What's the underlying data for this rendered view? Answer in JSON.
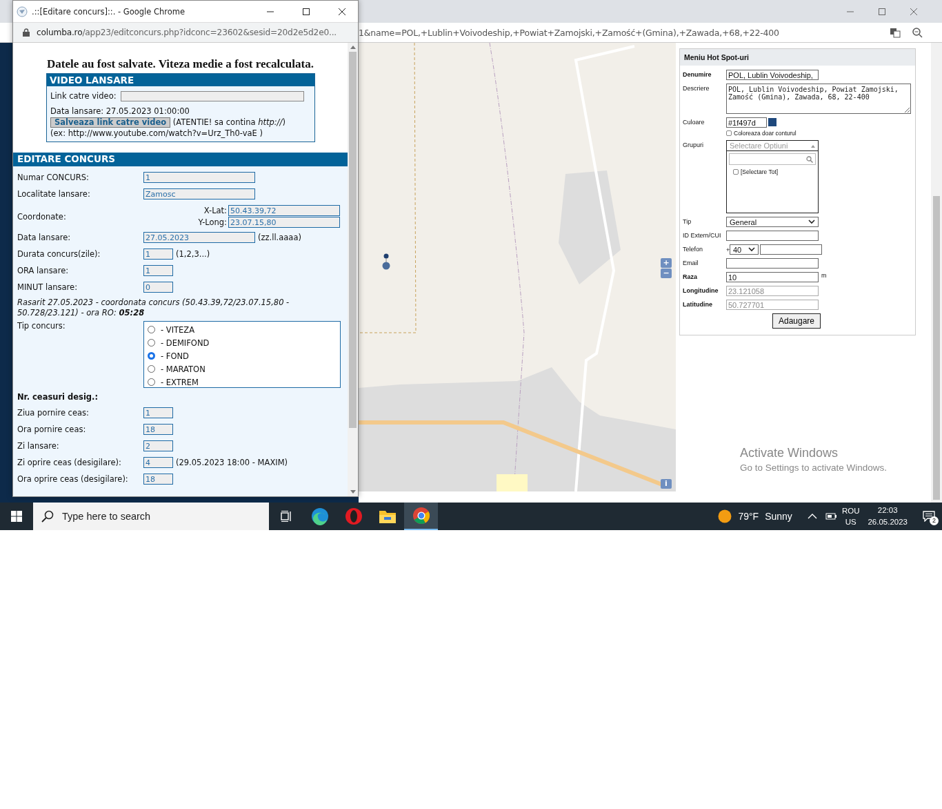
{
  "background_window": {
    "url": "1&name=POL,+Lublin+Voivodeship,+Powiat+Zamojski,+Zamość+(Gmina),+Zawada,+68,+22-400",
    "map": {
      "zoom_in": "+",
      "zoom_out": "−",
      "info": "i"
    },
    "panel": {
      "title": "Meniu Hot Spot-uri",
      "name_label": "Denumire",
      "name_value": "POL, Lublin Voivodeship,",
      "desc_label": "Descriere",
      "desc_value": "POL, Lublin Voivodeship, Powiat Zamojski, Zamość (Gmina), Zawada, 68, 22-400",
      "color_label": "Culoare",
      "color_value": "#1f497d",
      "outline_label": "Coloreaza doar conturul",
      "outline_checked": false,
      "groups_label": "Grupuri",
      "groups_placeholder": "Selectare Optiuni",
      "groups_expanded": true,
      "groups_options": [
        {
          "label": "[Selectare Tot]",
          "checked": false
        }
      ],
      "type_label": "Tip",
      "type_value": "General",
      "extid_label": "ID Extern/CUI",
      "phone_label": "Telefon",
      "phone_plus": "+",
      "phone_prefix": "40",
      "email_label": "Email",
      "radius_label": "Raza",
      "radius_value": "10",
      "radius_unit": "m",
      "lon_label": "Longitudine",
      "lon_value": "23.121058",
      "lat_label": "Latitudine",
      "lat_value": "50.727701",
      "submit": "Adaugare"
    }
  },
  "popup": {
    "title": ".::[Editare concurs]::. - Google Chrome",
    "url_host": "columba.ro",
    "url_path": "/app23/editconcurs.php?idconc=23602&sesid=20d2e5d2e0...",
    "message": "Datele au fost salvate. Viteza medie a fost recalculata.",
    "video": {
      "heading": "VIDEO LANSARE",
      "link_label": "Link catre video:",
      "date_text": "Data lansare: 27.05.2023 01:00:00",
      "save_button": "Salveaza link catre video",
      "warning": "(ATENTIE! sa contina *http://*)",
      "example": "(ex: http://www.youtube.com/watch?v=Urz_Th0-vaE )"
    },
    "edit": {
      "heading": "EDITARE CONCURS",
      "fields_top": [
        {
          "label": "Numar CONCURS:",
          "value": "1",
          "kind": "wide"
        },
        {
          "label": "Localitate lansare:",
          "value": "Zamosc",
          "kind": "wide"
        }
      ],
      "coords": {
        "label": "Coordonate:",
        "x_label": "X-Lat:",
        "x_value": "50.43.39,72",
        "y_label": "Y-Long:",
        "y_value": "23.07.15,80"
      },
      "fields_mid": [
        {
          "label": "Data lansare:",
          "value": "27.05.2023",
          "kind": "wide",
          "hint": "(zz.ll.aaaa)"
        },
        {
          "label": "Durata concurs(zile):",
          "value": "1",
          "kind": "short",
          "hint": "(1,2,3...)"
        },
        {
          "label": "ORA lansare:",
          "value": "1",
          "kind": "short"
        },
        {
          "label": "MINUT lansare:",
          "value": "0",
          "kind": "short"
        }
      ],
      "sunrise": "Rasarit 27.05.2023 - coordonata concurs (50.43.39,72/23.07.15,80 - 50.728/23.121) - ora RO: **05:28**",
      "type_label": "Tip concurs:",
      "type_options": [
        {
          "label": "- VITEZA",
          "selected": false
        },
        {
          "label": "- DEMIFOND",
          "selected": false
        },
        {
          "label": "- FOND",
          "selected": true
        },
        {
          "label": "- MARATON",
          "selected": false
        },
        {
          "label": "- EXTREM",
          "selected": false
        }
      ],
      "clocks_heading": "Nr. ceasuri desig.:",
      "fields_bottom": [
        {
          "label": "Ziua pornire ceas:",
          "value": "1",
          "kind": "short"
        },
        {
          "label": "Ora pornire ceas:",
          "value": "18",
          "kind": "short"
        },
        {
          "label": "Zi lansare:",
          "value": "2",
          "kind": "short"
        },
        {
          "label": "Zi oprire ceas (desigilare):",
          "value": "4",
          "kind": "short",
          "hint": "(29.05.2023 18:00 - MAXIM)"
        },
        {
          "label": "Ora oprire ceas (desigilare):",
          "value": "18",
          "kind": "short"
        }
      ]
    }
  },
  "activation": {
    "title": "Activate Windows",
    "subtitle": "Go to Settings to activate Windows."
  },
  "taskbar": {
    "search_placeholder": "Type here to search",
    "apps": [
      {
        "kind": "taskview",
        "selected": false
      },
      {
        "kind": "edge",
        "selected": false
      },
      {
        "kind": "opera",
        "selected": false
      },
      {
        "kind": "explorer",
        "selected": false
      },
      {
        "kind": "chrome",
        "selected": true
      }
    ],
    "temperature": "79°F",
    "weather": "Sunny",
    "lang_top": "ROU",
    "lang_bottom": "US",
    "time": "22:03",
    "date": "26.05.2023",
    "notifications": "2"
  }
}
